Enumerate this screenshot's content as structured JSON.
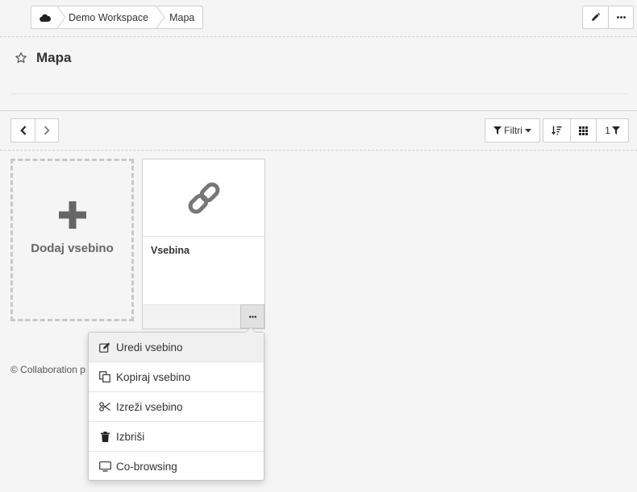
{
  "breadcrumb": {
    "home_icon": "cloud-icon",
    "items": [
      "Demo Workspace",
      "Mapa"
    ]
  },
  "top_actions": [
    "pencil-icon",
    "ellipsis-icon"
  ],
  "page": {
    "title": "Mapa",
    "favorite_icon": "star-outline-icon"
  },
  "toolbar": {
    "filter_label": "Filtri",
    "count_label": "1"
  },
  "add_card": {
    "label": "Dodaj vsebino"
  },
  "content_card": {
    "title": "Vsebina",
    "icon": "link-icon"
  },
  "footer": {
    "text": "© Collaboration p"
  },
  "context_menu": {
    "items": [
      {
        "label": "Uredi vsebino",
        "icon": "edit-icon"
      },
      {
        "label": "Kopiraj vsebino",
        "icon": "copy-icon"
      },
      {
        "label": "Izreži vsebino",
        "icon": "scissors-icon"
      },
      {
        "label": "Izbriši",
        "icon": "trash-icon"
      },
      {
        "label": "Co-browsing",
        "icon": "monitor-icon"
      }
    ]
  },
  "colors": {
    "background": "#f5f5f6",
    "border": "#cfcfcf",
    "text": "#333333",
    "icon": "#222222",
    "muted_icon": "#777777"
  }
}
